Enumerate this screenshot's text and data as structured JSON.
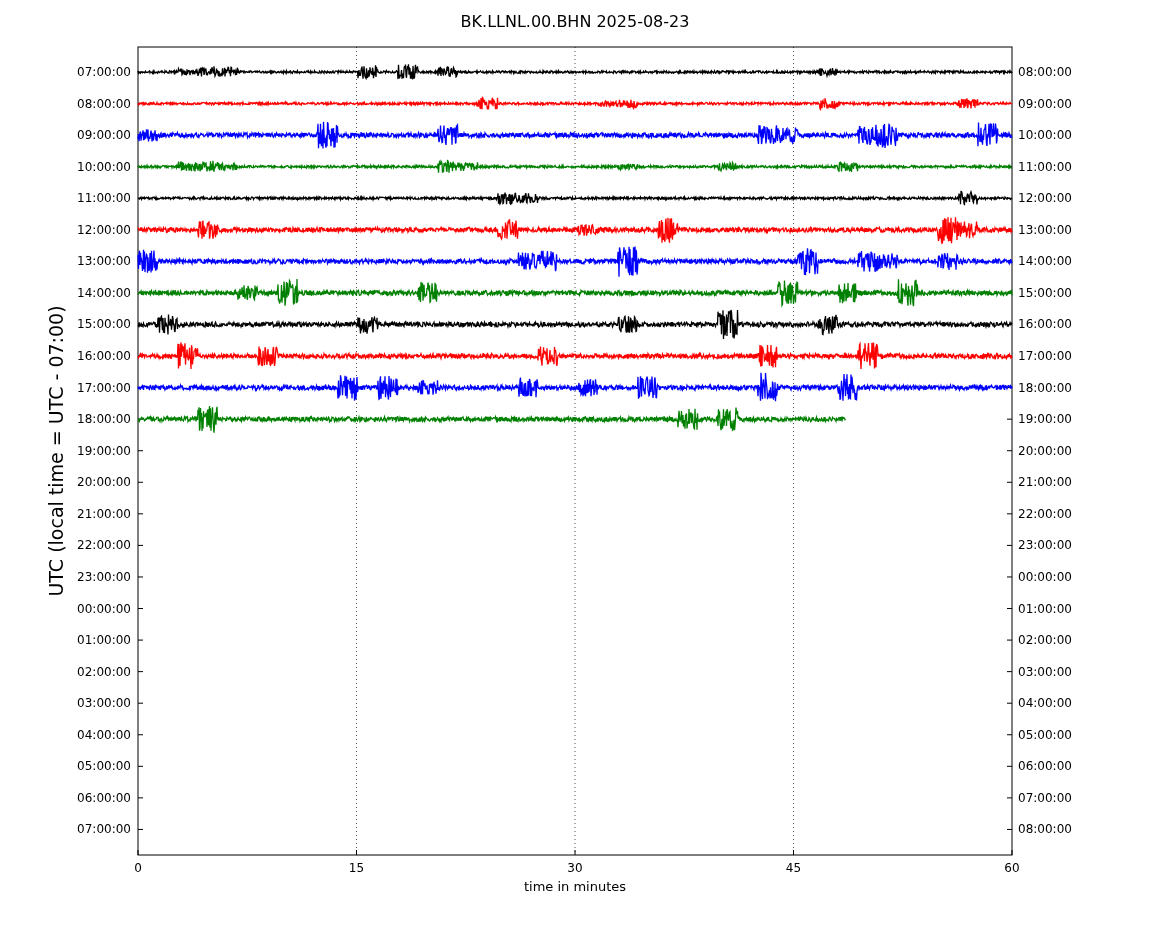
{
  "title": "BK.LLNL.00.BHN 2025-08-23",
  "chart": {
    "xlabel": "time in minutes",
    "ylabel": "UTC (local time = UTC - 07:00)",
    "xticks": [
      "0",
      "15",
      "30",
      "45",
      "60"
    ],
    "rows": [
      {
        "left": "07:00:00",
        "right": "08:00:00",
        "trace": {
          "color": "#000000",
          "level": 1
        }
      },
      {
        "left": "08:00:00",
        "right": "09:00:00",
        "trace": {
          "color": "#ff0000",
          "level": 1
        }
      },
      {
        "left": "09:00:00",
        "right": "10:00:00",
        "trace": {
          "color": "#0000ff",
          "level": 1
        }
      },
      {
        "left": "10:00:00",
        "right": "11:00:00",
        "trace": {
          "color": "#008000",
          "level": 1
        }
      },
      {
        "left": "11:00:00",
        "right": "12:00:00",
        "trace": {
          "color": "#000000",
          "level": 1
        }
      },
      {
        "left": "12:00:00",
        "right": "13:00:00",
        "trace": {
          "color": "#ff0000",
          "level": 1
        }
      },
      {
        "left": "13:00:00",
        "right": "14:00:00",
        "trace": {
          "color": "#0000ff",
          "level": 1
        }
      },
      {
        "left": "14:00:00",
        "right": "15:00:00",
        "trace": {
          "color": "#008000",
          "level": 1
        }
      },
      {
        "left": "15:00:00",
        "right": "16:00:00",
        "trace": {
          "color": "#000000",
          "level": 1
        }
      },
      {
        "left": "16:00:00",
        "right": "17:00:00",
        "trace": {
          "color": "#ff0000",
          "level": 1
        }
      },
      {
        "left": "17:00:00",
        "right": "18:00:00",
        "trace": {
          "color": "#0000ff",
          "level": 1
        }
      },
      {
        "left": "18:00:00",
        "right": "19:00:00",
        "trace": {
          "color": "#008000",
          "level": 0.81
        }
      },
      {
        "left": "19:00:00",
        "right": "20:00:00"
      },
      {
        "left": "20:00:00",
        "right": "21:00:00"
      },
      {
        "left": "21:00:00",
        "right": "22:00:00"
      },
      {
        "left": "22:00:00",
        "right": "23:00:00"
      },
      {
        "left": "23:00:00",
        "right": "00:00:00"
      },
      {
        "left": "00:00:00",
        "right": "01:00:00"
      },
      {
        "left": "01:00:00",
        "right": "02:00:00"
      },
      {
        "left": "02:00:00",
        "right": "03:00:00"
      },
      {
        "left": "03:00:00",
        "right": "04:00:00"
      },
      {
        "left": "04:00:00",
        "right": "05:00:00"
      },
      {
        "left": "05:00:00",
        "right": "06:00:00"
      },
      {
        "left": "06:00:00",
        "right": "07:00:00"
      },
      {
        "left": "07:00:00",
        "right": "08:00:00"
      }
    ]
  }
}
